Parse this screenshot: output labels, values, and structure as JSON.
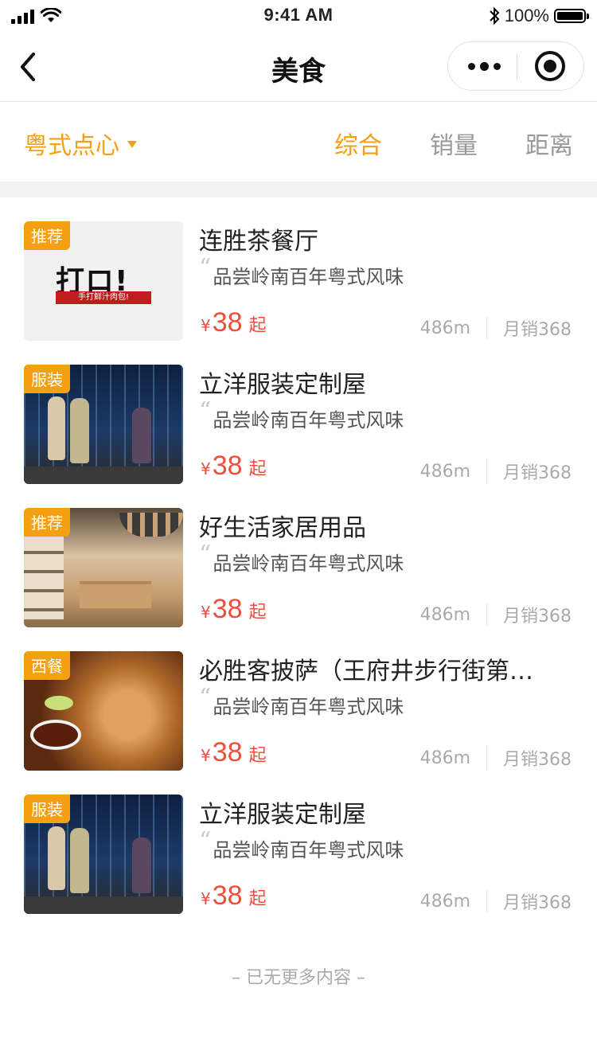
{
  "status_bar": {
    "time": "9:41 AM",
    "battery": "100%"
  },
  "nav": {
    "title": "美食"
  },
  "filter": {
    "category": "粤式点心",
    "sort_tabs": [
      {
        "label": "综合",
        "active": true
      },
      {
        "label": "销量",
        "active": false
      },
      {
        "label": "距离",
        "active": false
      }
    ]
  },
  "items": [
    {
      "tag": "推荐",
      "title": "连胜茶餐厅",
      "quote": "品尝岭南百年粤式风味",
      "price_symbol": "¥",
      "price": "38",
      "price_suffix": "起",
      "distance": "486m",
      "sales": "月销368"
    },
    {
      "tag": "服装",
      "title": "立洋服装定制屋",
      "quote": "品尝岭南百年粤式风味",
      "price_symbol": "¥",
      "price": "38",
      "price_suffix": "起",
      "distance": "486m",
      "sales": "月销368"
    },
    {
      "tag": "推荐",
      "title": "好生活家居用品",
      "quote": "品尝岭南百年粤式风味",
      "price_symbol": "¥",
      "price": "38",
      "price_suffix": "起",
      "distance": "486m",
      "sales": "月销368"
    },
    {
      "tag": "西餐",
      "title": "必胜客披萨（王府井步行街第…",
      "quote": "品尝岭南百年粤式风味",
      "price_symbol": "¥",
      "price": "38",
      "price_suffix": "起",
      "distance": "486m",
      "sales": "月销368"
    },
    {
      "tag": "服装",
      "title": "立洋服装定制屋",
      "quote": "品尝岭南百年粤式风味",
      "price_symbol": "¥",
      "price": "38",
      "price_suffix": "起",
      "distance": "486m",
      "sales": "月销368"
    }
  ],
  "logo": {
    "main": "打ロ!",
    "sub": "手打鲜汁肉包!"
  },
  "footer": {
    "text": "– 已无更多内容 –"
  },
  "colors": {
    "accent": "#f5a012",
    "price": "#f04d3c"
  }
}
